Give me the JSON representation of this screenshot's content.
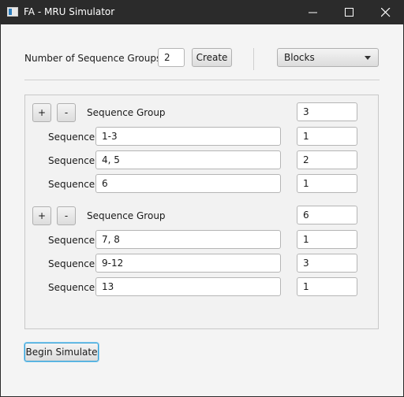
{
  "window": {
    "title": "FA - MRU Simulator"
  },
  "header": {
    "groups_label": "Number of Sequence Groups",
    "groups_value": "2",
    "create_label": "Create",
    "mode_selected": "Blocks"
  },
  "groups": [
    {
      "add_label": "+",
      "remove_label": "-",
      "group_label": "Sequence Group",
      "group_count": "3",
      "sequences": [
        {
          "label": "Sequence",
          "value": "1-3",
          "count": "1"
        },
        {
          "label": "Sequence",
          "value": "4, 5",
          "count": "2"
        },
        {
          "label": "Sequence",
          "value": "6",
          "count": "1"
        }
      ]
    },
    {
      "add_label": "+",
      "remove_label": "-",
      "group_label": "Sequence Group",
      "group_count": "6",
      "sequences": [
        {
          "label": "Sequence",
          "value": "7, 8",
          "count": "1"
        },
        {
          "label": "Sequence",
          "value": "9-12",
          "count": "3"
        },
        {
          "label": "Sequence",
          "value": "13",
          "count": "1"
        }
      ]
    }
  ],
  "footer": {
    "begin_label": "Begin Simulate"
  },
  "colors": {
    "titlebar": "#2b2b2b",
    "background": "#f4f4f4",
    "focus_ring": "#2f9fd6"
  }
}
